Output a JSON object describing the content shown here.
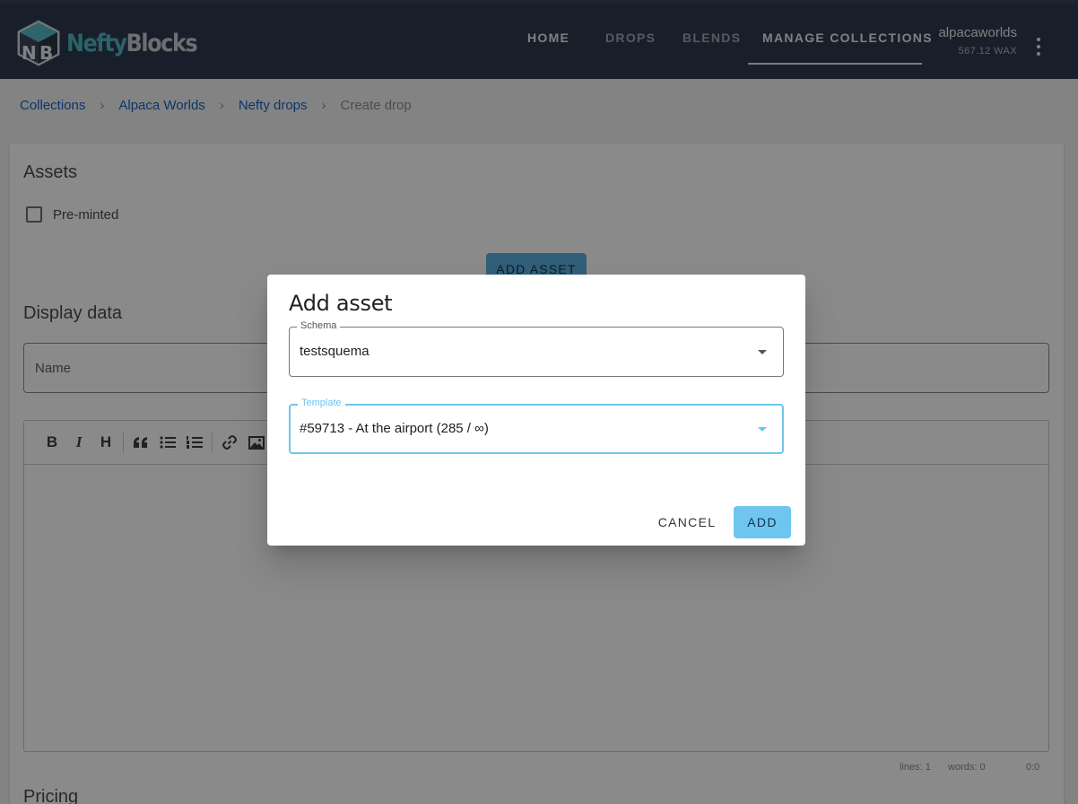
{
  "header": {
    "logo": {
      "text_a": "Nefty",
      "text_b": "Blocks",
      "mark": "NB"
    },
    "nav": [
      {
        "label": "HOME"
      },
      {
        "label": "DROPS"
      },
      {
        "label": "BLENDS"
      },
      {
        "label": "MANAGE COLLECTIONS",
        "active": true
      }
    ],
    "account": {
      "name": "alpacaworlds",
      "balance": "567.12 WAX"
    },
    "menu_icon": "more-vertical-icon"
  },
  "breadcrumb": {
    "items": [
      "Collections",
      "Alpaca Worlds",
      "Nefty drops"
    ],
    "current": "Create drop",
    "separator": "›"
  },
  "assets": {
    "title": "Assets",
    "preminted_label": "Pre-minted",
    "add_asset_label": "ADD ASSET"
  },
  "display_data": {
    "title": "Display data",
    "name_label": "Name",
    "toolbar": [
      "B",
      "I",
      "H"
    ],
    "status": {
      "lines": "lines: 1",
      "words": "words: 0",
      "cursor": "0:0"
    }
  },
  "pricing": {
    "title": "Pricing"
  },
  "dialog": {
    "title": "Add asset",
    "schema": {
      "label": "Schema",
      "value": "testsquema"
    },
    "template": {
      "label": "Template",
      "value": "#59713 - At the airport (285 / ∞)"
    },
    "cancel_label": "CANCEL",
    "add_label": "ADD"
  },
  "colors": {
    "header_bg": "#2f3a4e",
    "link": "#1565c0",
    "accent": "#6ec6f0",
    "logo_teal": "#4fb7c4"
  }
}
